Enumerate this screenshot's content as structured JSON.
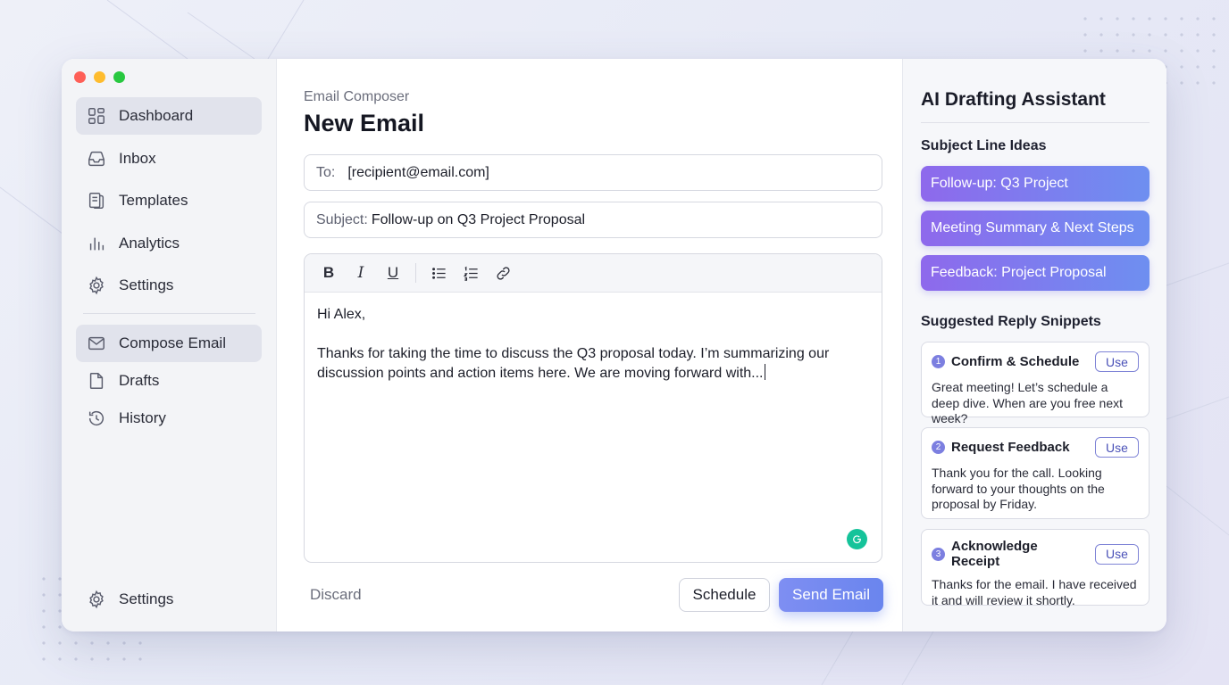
{
  "sidebar": {
    "nav_top": [
      {
        "label": "Dashboard",
        "icon": "grid-icon",
        "active": true
      },
      {
        "label": "Inbox",
        "icon": "inbox-icon",
        "active": false
      },
      {
        "label": "Templates",
        "icon": "templates-icon",
        "active": false
      },
      {
        "label": "Analytics",
        "icon": "bar-chart-icon",
        "active": false
      },
      {
        "label": "Settings",
        "icon": "gear-icon",
        "active": false
      }
    ],
    "nav_bottom": [
      {
        "label": "Compose Email",
        "icon": "envelope-icon",
        "active": true
      },
      {
        "label": "Drafts",
        "icon": "document-icon",
        "active": false
      },
      {
        "label": "History",
        "icon": "history-icon",
        "active": false
      }
    ],
    "footer_settings": "Settings"
  },
  "composer": {
    "kicker": "Email Composer",
    "title": "New Email",
    "to_label": "To:",
    "to_value": "[recipient@email.com]",
    "subject_label": "Subject:",
    "subject_value": "Follow-up on Q3 Project Proposal",
    "toolbar": [
      "B",
      "I",
      "U"
    ],
    "body_greeting": "Hi Alex,",
    "body_text": "Thanks for taking the time to discuss the Q3 proposal today. I’m summarizing our discussion points and action items here. We are moving forward with...",
    "discard_label": "Discard",
    "schedule_label": "Schedule",
    "send_label": "Send Email"
  },
  "assistant": {
    "title": "AI Drafting Assistant",
    "subject_heading": "Subject Line Ideas",
    "subject_ideas": [
      "Follow-up: Q3 Project",
      "Meeting Summary & Next Steps",
      "Feedback: Project Proposal"
    ],
    "snippets_heading": "Suggested Reply Snippets",
    "snippets": [
      {
        "num": "1",
        "title": "Confirm & Schedule",
        "use": "Use",
        "text": "Great meeting! Let’s schedule a deep dive. When are you free next week?"
      },
      {
        "num": "2",
        "title": "Request Feedback",
        "use": "Use",
        "text": "Thank you for the call. Looking forward to your thoughts on the proposal by Friday."
      },
      {
        "num": "3",
        "title": "Acknowledge Receipt",
        "use": "Use",
        "text": "Thanks for the email. I have received it and will review it shortly."
      }
    ]
  },
  "colors": {
    "accent_gradient_start": "#8e69ec",
    "accent_gradient_end": "#6e8ff0",
    "send_button": "#7484f0",
    "grammarly_green": "#15c39a"
  }
}
